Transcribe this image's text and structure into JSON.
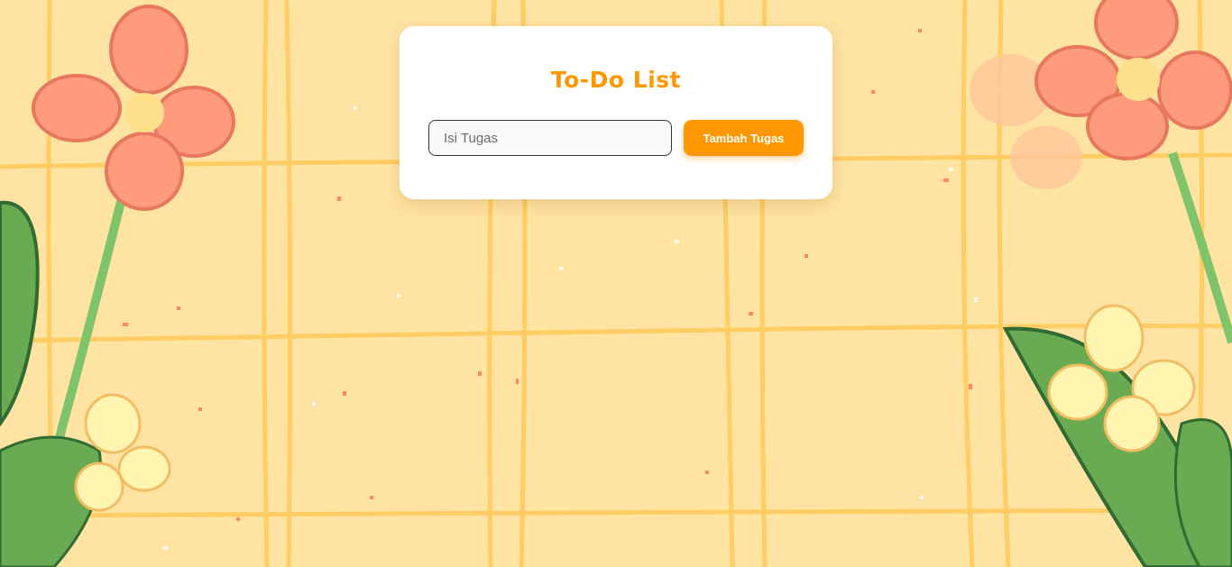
{
  "app": {
    "title": "To-Do List"
  },
  "form": {
    "input_placeholder": "Isi Tugas",
    "input_value": "",
    "add_button_label": "Tambah Tugas"
  },
  "theme": {
    "accent": "#ff9800",
    "background": "#ffe3a3",
    "card": "#ffffff"
  }
}
